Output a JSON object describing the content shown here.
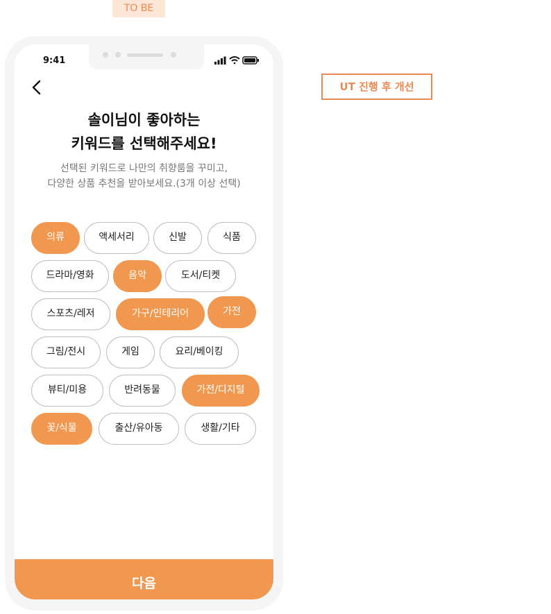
{
  "annotation": {
    "tobe_label": "TO BE",
    "ut_label": "UT 진행 후 개선"
  },
  "status": {
    "time": "9:41"
  },
  "header": {
    "title_line1": "솔이님이 좋아하는",
    "title_line2": "키워드를 선택해주세요!",
    "subtitle_line1": "선택된 키워드로 나만의 취향룸을 꾸미고,",
    "subtitle_line2": "다양한 상품 추천을 받아보세요.(3개 이상 선택)"
  },
  "keywords": [
    {
      "label": "의류",
      "selected": true
    },
    {
      "label": "액세서리",
      "selected": false
    },
    {
      "label": "신발",
      "selected": false
    },
    {
      "label": "식품",
      "selected": false
    },
    {
      "label": "드라마/영화",
      "selected": false
    },
    {
      "label": "음악",
      "selected": true
    },
    {
      "label": "도서/티켓",
      "selected": false
    },
    {
      "label": "스포츠/레저",
      "selected": false
    },
    {
      "label": "가구/인테리어",
      "selected": true
    },
    {
      "label": "가전",
      "selected": true
    },
    {
      "label": "그림/전시",
      "selected": false
    },
    {
      "label": "게임",
      "selected": false
    },
    {
      "label": "요리/베이킹",
      "selected": false
    },
    {
      "label": "뷰티/미용",
      "selected": false
    },
    {
      "label": "반려동물",
      "selected": false
    },
    {
      "label": "가전/디지털",
      "selected": true
    },
    {
      "label": "꽃/식물",
      "selected": true
    },
    {
      "label": "출산/유아동",
      "selected": false
    },
    {
      "label": "생활/기타",
      "selected": false
    }
  ],
  "footer": {
    "next_label": "다음"
  },
  "colors": {
    "accent": "#f0984f",
    "chip_border": "#bdbdbd",
    "annotation": "#e98a52"
  }
}
